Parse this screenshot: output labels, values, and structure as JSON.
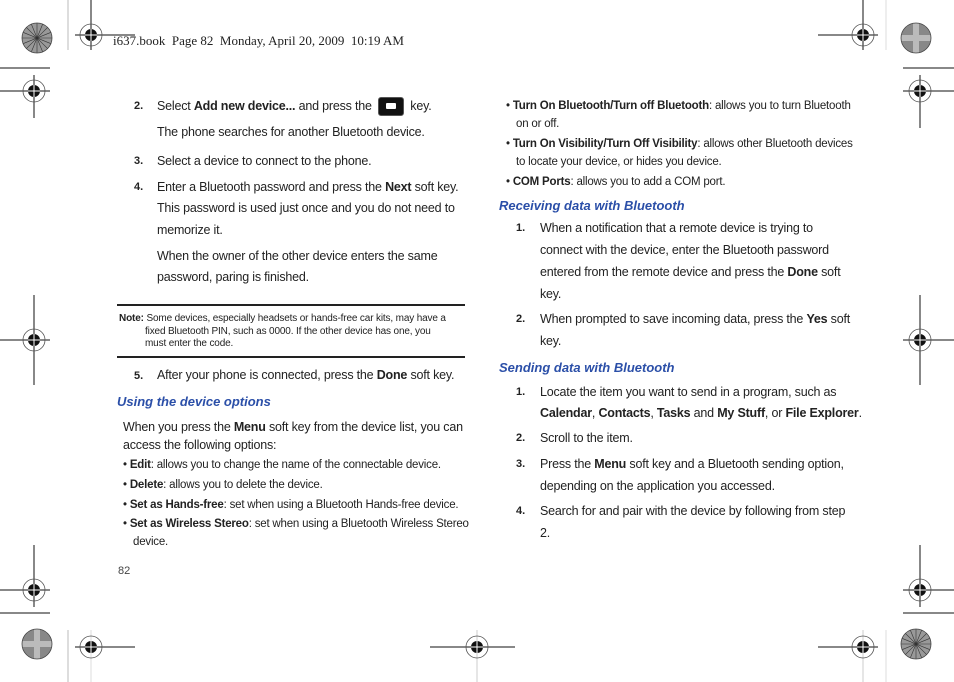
{
  "header": {
    "print_line": "i637.book  Page 82  Monday, April 20, 2009  10:19 AM"
  },
  "page_number": "82",
  "left_column": {
    "steps_a": [
      {
        "num": "2.",
        "pre": "Select ",
        "bold": "Add new device...",
        "mid": " and press the ",
        "icon": "ok-key-icon",
        "post": " key."
      },
      {
        "sub": "The phone searches for another Bluetooth device."
      },
      {
        "num": "3.",
        "text": "Select a device to connect to the phone."
      },
      {
        "num": "4.",
        "pre": "Enter a Bluetooth password and press the ",
        "bold": "Next",
        "post": " soft key."
      },
      {
        "sub": "This password is used just once and you do not need to"
      },
      {
        "sub": "memorize it."
      },
      {
        "sub": "When the owner of the other device enters the same"
      },
      {
        "sub": "password, paring is finished."
      }
    ],
    "note": {
      "label": "Note:",
      "lines": [
        "Some devices, especially headsets or hands-free car kits, may have a",
        "fixed Bluetooth PIN, such as 0000. If the other device has one, you",
        "must enter the code."
      ]
    },
    "step5": {
      "num": "5.",
      "pre": "After your phone is connected, press the ",
      "bold": "Done",
      "post": " soft key."
    },
    "section_heading": "Using the device options",
    "intro": {
      "pre": "When you press the ",
      "bold": "Menu",
      "post": " soft key from the device list, you can",
      "line2": "access the following options:"
    },
    "options": [
      {
        "bold": "Edit",
        "text": ": allows you to change the name of the connectable device."
      },
      {
        "bold": "Delete",
        "text": ": allows you to delete the device."
      },
      {
        "bold": "Set as Hands-free",
        "text": ": set when using a Bluetooth Hands-free device."
      },
      {
        "bold": "Set as Wireless Stereo",
        "text": ": set when using a Bluetooth Wireless Stereo",
        "cont": "device."
      }
    ]
  },
  "right_column": {
    "options": [
      {
        "bold": "Turn On Bluetooth/Turn off Bluetooth",
        "text": ": allows you to turn Bluetooth",
        "cont": "on or off."
      },
      {
        "bold": "Turn On Visibility/Turn Off Visibility",
        "text": ": allows other Bluetooth devices",
        "cont": "to locate your device, or hides you device."
      },
      {
        "bold": "COM Ports",
        "text": ": allows you to add a COM port."
      }
    ],
    "receiving": {
      "heading": "Receiving data with Bluetooth",
      "steps": [
        {
          "num": "1.",
          "lines": [
            "When a notification that a remote device is trying to",
            "connect with the device, enter the Bluetooth password"
          ],
          "pre3": "entered from the remote device and press the ",
          "bold3": "Done",
          "post3": " soft",
          "line4": "key."
        },
        {
          "num": "2.",
          "pre": "When prompted to save incoming data, press the ",
          "bold": "Yes",
          "post": " soft",
          "line2": "key."
        }
      ]
    },
    "sending": {
      "heading": "Sending data with Bluetooth",
      "steps": [
        {
          "num": "1.",
          "line1": "Locate the item you want to send in a program, such as",
          "b1": "Calendar",
          "s1": ", ",
          "b2": "Contacts",
          "s2": ", ",
          "b3": "Tasks",
          "s3": " and ",
          "b4": "My Stuff",
          "s4": ", or ",
          "b5": "File Explorer",
          "s5": "."
        },
        {
          "num": "2.",
          "text": "Scroll to the item."
        },
        {
          "num": "3.",
          "pre": "Press the ",
          "bold": "Menu",
          "post": " soft key and a Bluetooth sending option,",
          "line2": "depending on the application you accessed."
        },
        {
          "num": "4.",
          "line1": "Search for and pair with the device by following from step",
          "line2": "2."
        }
      ]
    }
  },
  "colors": {
    "heading_blue": "#2b4fa8",
    "text": "#222222"
  }
}
